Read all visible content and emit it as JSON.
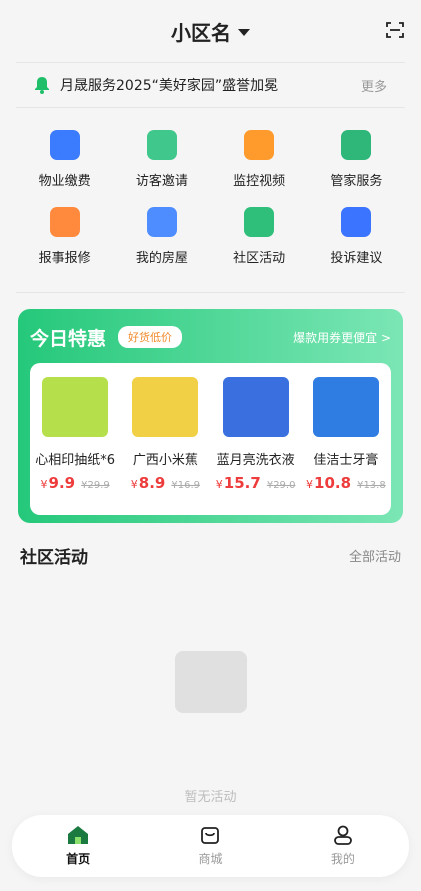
{
  "header": {
    "title": "小区名",
    "scan_icon": "scan-icon"
  },
  "notice": {
    "text": "月晟服务2025“美好家园”盛誉加冕",
    "more": "更多",
    "icon": "bell-icon"
  },
  "services": [
    {
      "label": "物业缴费",
      "icon": "bill-icon",
      "color": "#3b7cff"
    },
    {
      "label": "访客邀请",
      "icon": "visitor-icon",
      "color": "#40c78c"
    },
    {
      "label": "监控视频",
      "icon": "camera-icon",
      "color": "#ff9a2d"
    },
    {
      "label": "管家服务",
      "icon": "butler-icon",
      "color": "#2fb77a"
    },
    {
      "label": "报事报修",
      "icon": "repair-icon",
      "color": "#ff8a3d"
    },
    {
      "label": "我的房屋",
      "icon": "house-icon",
      "color": "#4d8dff"
    },
    {
      "label": "社区活动",
      "icon": "event-icon",
      "color": "#2fbf7a"
    },
    {
      "label": "投诉建议",
      "icon": "feedback-icon",
      "color": "#3b74ff"
    }
  ],
  "deals": {
    "title": "今日特惠",
    "badge": "好货低价",
    "link": "爆款用券更便宜 >",
    "currency": "¥",
    "items": [
      {
        "name": "心相印抽纸*6",
        "price": "9.9",
        "old": "29.9",
        "color": "#b6e04b"
      },
      {
        "name": "广西小米蕉",
        "price": "8.9",
        "old": "16.9",
        "color": "#f2d046"
      },
      {
        "name": "蓝月亮洗衣液",
        "price": "15.7",
        "old": "29.0",
        "color": "#3a6fe0"
      },
      {
        "name": "佳洁士牙膏",
        "price": "10.8",
        "old": "13.8",
        "color": "#2f7de2"
      }
    ]
  },
  "activities": {
    "title": "社区活动",
    "all": "全部活动",
    "empty": "暂无活动"
  },
  "tabs": [
    {
      "label": "首页",
      "icon": "home-icon",
      "active": true
    },
    {
      "label": "商城",
      "icon": "shop-icon",
      "active": false
    },
    {
      "label": "我的",
      "icon": "profile-icon",
      "active": false
    }
  ]
}
